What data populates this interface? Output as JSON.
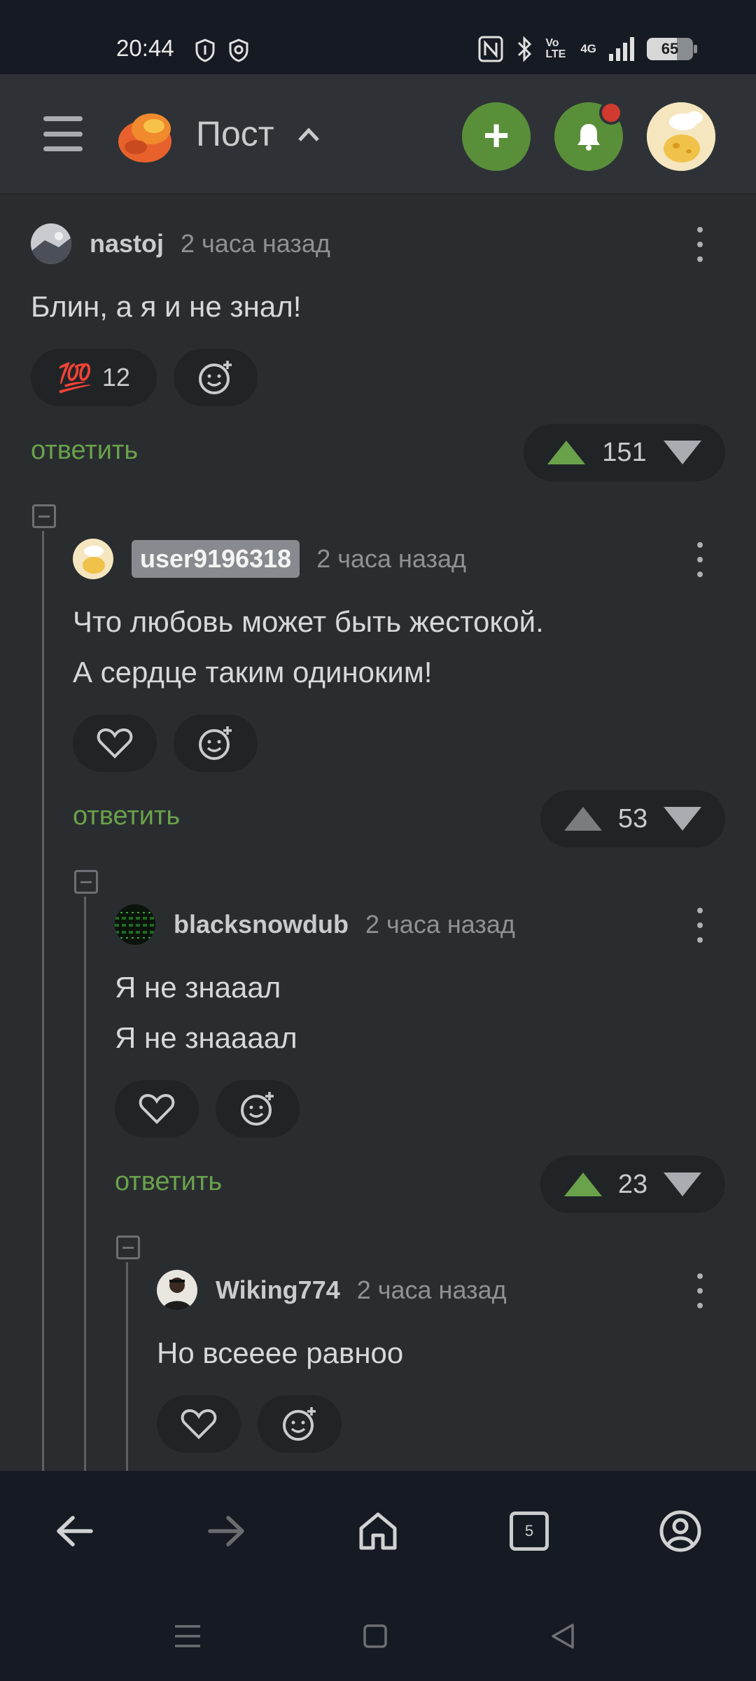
{
  "status": {
    "time": "20:44",
    "battery": "65",
    "network": "4G",
    "volte": "Vo LTE"
  },
  "header": {
    "title": "Пост",
    "caret": "^",
    "add_icon": "plus-icon",
    "bell_icon": "bell-icon",
    "accent": "#5a8f3a",
    "notif_color": "#d13a2f"
  },
  "comments": [
    {
      "username": "nastoj",
      "time": "2 часа назад",
      "lines": [
        "Блин, а я и не знал!"
      ],
      "reaction": {
        "emoji": "💯",
        "count": "12"
      },
      "reply": "ответить",
      "votes": "151",
      "upvoted": true
    },
    {
      "username": "user9196318",
      "time": "2 часа назад",
      "lines": [
        "Что любовь может быть жестокой.",
        "А сердце таким одиноким!"
      ],
      "reply": "ответить",
      "votes": "53",
      "upvoted": false
    },
    {
      "username": "blacksnowdub",
      "time": "2 часа назад",
      "lines": [
        "Я не знааал",
        "Я не знаааал"
      ],
      "reply": "ответить",
      "votes": "23",
      "upvoted": true
    },
    {
      "username": "Wiking774",
      "time": "2 часа назад",
      "lines": [
        "Но всееее равноо"
      ]
    }
  ],
  "bottom_bar": {
    "tabs_count": "5",
    "icons": [
      "back-arrow-icon",
      "forward-arrow-icon",
      "home-icon",
      "tabs-icon",
      "profile-icon"
    ]
  }
}
